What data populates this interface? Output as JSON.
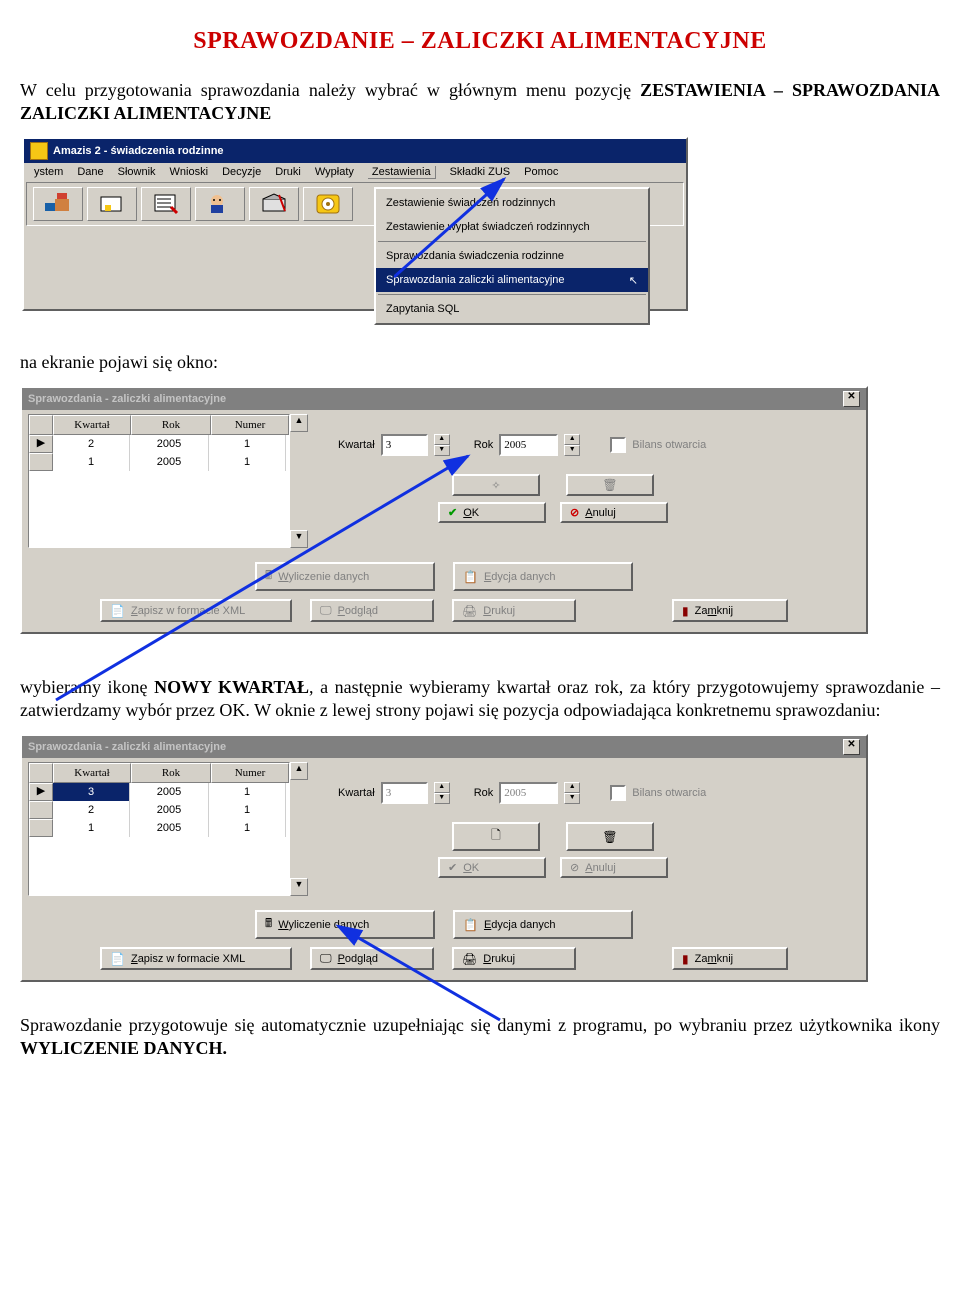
{
  "doc": {
    "h1": "SPRAWOZDANIE – ZALICZKI ALIMENTACYJNE",
    "p1a": "W celu przygotowania sprawozdania należy wybrać w głównym menu pozycję ",
    "p1b": "ZESTAWIENIA – SPRAWOZDANIA ZALICZKI ALIMENTACYJNE",
    "p2": "na ekranie pojawi się okno:",
    "p3a": "wybieramy ikonę ",
    "p3b": "NOWY KWARTAŁ",
    "p3c": ", a następnie wybieramy kwartał oraz rok, za który przygotowujemy sprawozdanie – zatwierdzamy wybór przez OK. W oknie z lewej strony pojawi się pozycja odpowiadająca konkretnemu sprawozdaniu:",
    "p4a": "Sprawozdanie przygotowuje się automatycznie uzupełniając się danymi z programu, po wybraniu przez użytkownika ikony ",
    "p4b": "WYLICZENIE DANYCH."
  },
  "shot1": {
    "title": "Amazis 2 - świadczenia rodzinne",
    "menu": [
      "ystem",
      "Dane",
      "Słownik",
      "Wnioski",
      "Decyzje",
      "Druki",
      "Wypłaty",
      "Zestawienia",
      "Składki ZUS",
      "Pomoc"
    ],
    "dropdown": [
      "Zestawienie świadczeń rodzinnych",
      "Zestawienie wypłat świadczeń rodzinnych",
      "Sprawozdania świadczenia rodzinne",
      "Sprawozdania zaliczki alimentacyjne",
      "Zapytania SQL"
    ],
    "dropdownSelected": 3
  },
  "dlg": {
    "title": "Sprawozdania - zaliczki alimentacyjne",
    "headers": {
      "k": "Kwartał",
      "r": "Rok",
      "n": "Numer"
    },
    "fields": {
      "kwartal_label": "Kwartał",
      "rok_label": "Rok",
      "bilans_label": "Bilans otwarcia"
    },
    "btns": {
      "ok": "OK",
      "anuluj": "Anuluj",
      "wylicz": "Wyliczenie danych",
      "edycja": "Edycja danych",
      "zapis": "Zapisz w formacie XML",
      "podglad": "Podgląd",
      "drukuj": "Drukuj",
      "zamknij": "Zamknij"
    }
  },
  "shot2": {
    "rows": [
      {
        "k": "2",
        "r": "2005",
        "n": "1"
      },
      {
        "k": "1",
        "r": "2005",
        "n": "1"
      }
    ],
    "kwartal": "3",
    "rok": "2005",
    "buttonsEnabled": false
  },
  "shot3": {
    "rows": [
      {
        "k": "3",
        "r": "2005",
        "n": "1",
        "sel": true
      },
      {
        "k": "2",
        "r": "2005",
        "n": "1"
      },
      {
        "k": "1",
        "r": "2005",
        "n": "1"
      }
    ],
    "kwartal": "3",
    "rok": "2005",
    "buttonsEnabled": true
  }
}
